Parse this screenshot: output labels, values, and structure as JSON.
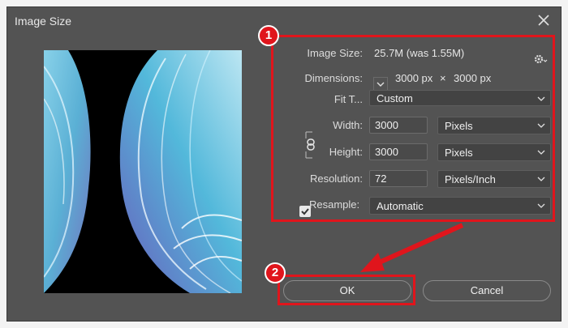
{
  "dialog": {
    "title": "Image Size",
    "image_size_label": "Image Size:",
    "image_size_value": "25.7M (was 1.55M)",
    "dimensions_label": "Dimensions:",
    "dim_width": "3000 px",
    "dim_x": "×",
    "dim_height": "3000 px",
    "fit_label": "Fit T...",
    "fit_value": "Custom",
    "width_label": "Width:",
    "width_value": "3000",
    "width_unit": "Pixels",
    "height_label": "Height:",
    "height_value": "3000",
    "height_unit": "Pixels",
    "resolution_label": "Resolution:",
    "resolution_value": "72",
    "resolution_unit": "Pixels/Inch",
    "resample_label": "Resample:",
    "resample_checked": true,
    "resample_value": "Automatic",
    "ok_label": "OK",
    "cancel_label": "Cancel"
  },
  "annotations": {
    "badge1": "1",
    "badge2": "2",
    "color": "#e0151c"
  },
  "colors": {
    "dialog_bg": "#535353",
    "text": "#dcdcdc"
  }
}
